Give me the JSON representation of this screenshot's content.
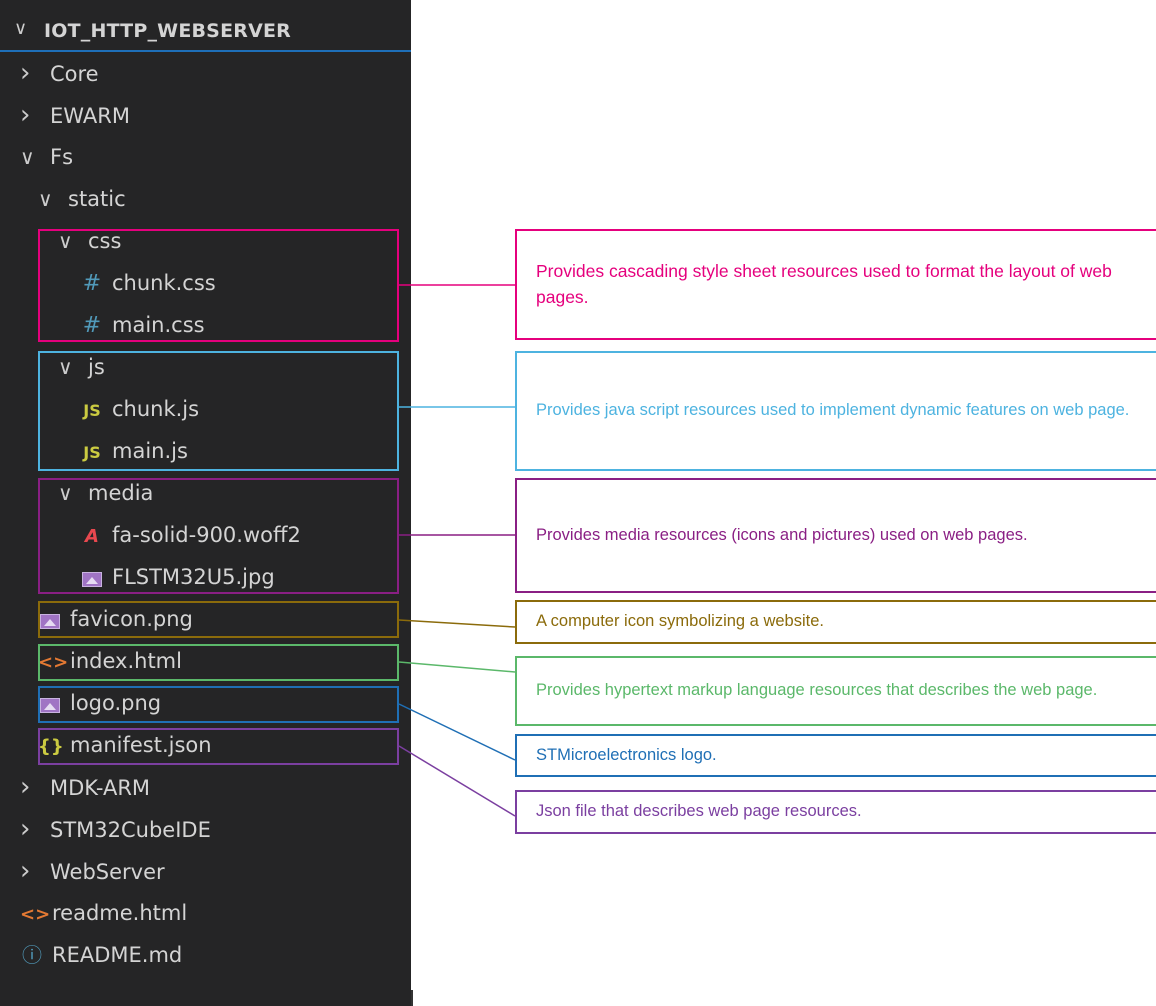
{
  "explorer": {
    "title": "IOT_HTTP_WEBSERVER",
    "tree": [
      {
        "label": "Core",
        "type": "folder",
        "expanded": false,
        "depth": 0
      },
      {
        "label": "EWARM",
        "type": "folder",
        "expanded": false,
        "depth": 0
      },
      {
        "label": "Fs",
        "type": "folder",
        "expanded": true,
        "depth": 0
      },
      {
        "label": "static",
        "type": "folder",
        "expanded": true,
        "depth": 1
      },
      {
        "label": "css",
        "type": "folder",
        "expanded": true,
        "depth": 2
      },
      {
        "label": "chunk.css",
        "type": "css",
        "icon": "hash-icon",
        "depth": 3
      },
      {
        "label": "main.css",
        "type": "css",
        "icon": "hash-icon",
        "depth": 3
      },
      {
        "label": "js",
        "type": "folder",
        "expanded": true,
        "depth": 2
      },
      {
        "label": "chunk.js",
        "type": "js",
        "icon": "js-icon",
        "depth": 3
      },
      {
        "label": "main.js",
        "type": "js",
        "icon": "js-icon",
        "depth": 3
      },
      {
        "label": "media",
        "type": "folder",
        "expanded": true,
        "depth": 2
      },
      {
        "label": "fa-solid-900.woff2",
        "type": "font",
        "icon": "font-file-icon",
        "depth": 3
      },
      {
        "label": "FLSTM32U5.jpg",
        "type": "image",
        "icon": "image-icon",
        "depth": 3
      },
      {
        "label": "favicon.png",
        "type": "image",
        "icon": "image-icon",
        "depth": 1
      },
      {
        "label": "index.html",
        "type": "html",
        "icon": "html-icon",
        "depth": 1
      },
      {
        "label": "logo.png",
        "type": "image",
        "icon": "image-icon",
        "depth": 1
      },
      {
        "label": "manifest.json",
        "type": "json",
        "icon": "json-braces-icon",
        "depth": 1
      },
      {
        "label": "MDK-ARM",
        "type": "folder",
        "expanded": false,
        "depth": 0
      },
      {
        "label": "STM32CubeIDE",
        "type": "folder",
        "expanded": false,
        "depth": 0
      },
      {
        "label": "WebServer",
        "type": "folder",
        "expanded": false,
        "depth": 0
      },
      {
        "label": "readme.html",
        "type": "html",
        "icon": "html-icon",
        "depth": -1
      },
      {
        "label": "README.md",
        "type": "info",
        "icon": "info-icon",
        "depth": -1
      }
    ]
  },
  "annotations": [
    {
      "id": "css",
      "text": "Provides cascading style sheet resources used to format the layout of web pages.",
      "color": "#e5007d"
    },
    {
      "id": "js",
      "text": "Provides java script resources used to implement dynamic features on web page.",
      "color": "#4db3e0"
    },
    {
      "id": "media",
      "text": "Provides media resources (icons and pictures) used on web pages.",
      "color": "#8a1f84"
    },
    {
      "id": "favicon",
      "text": "A computer icon symbolizing a website.",
      "color": "#8b6b0b"
    },
    {
      "id": "index",
      "text": "Provides hypertext markup language resources that describes the web page.",
      "color": "#5bb86a"
    },
    {
      "id": "logo",
      "text": "STMicroelectronics logo.",
      "color": "#1f6fb5"
    },
    {
      "id": "manifest",
      "text": "Json file that describes web page resources.",
      "color": "#7b3fa0"
    }
  ]
}
